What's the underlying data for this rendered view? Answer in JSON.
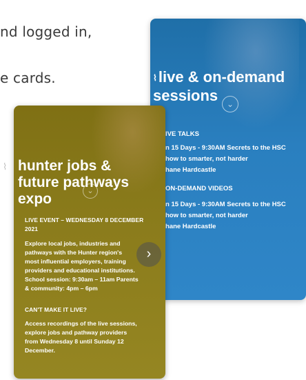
{
  "background_text": {
    "line1": "nd logged in,",
    "line2": "e cards."
  },
  "blue_card": {
    "title_line1": "live & on-demand",
    "title_line2": "sessions",
    "section1_heading": "IVE TALKS",
    "section1_lines": [
      "n 15 Days - 9:30AM Secrets to the HSC",
      "how to smarter, not harder",
      "hane Hardcastle"
    ],
    "section2_heading": "ON-DEMAND VIDEOS",
    "section2_lines": [
      "n 15 Days - 9:30AM Secrets to the HSC",
      "how to smarter, not harder",
      "hane Hardcastle"
    ],
    "accent": "#2a7fbf"
  },
  "olive_card": {
    "title_line1": "hunter jobs &",
    "title_line2": "future pathways",
    "title_line3": "expo",
    "event_label_line1": "LIVE EVENT – WEDNESDAY 8 DECEMBER",
    "event_label_line2": "2021",
    "description": [
      "Explore local jobs, industries and",
      "pathways with the Hunter region's",
      "most influential employers, training",
      "providers and educational institutions.",
      "School session: 9:30am – 11am Parents",
      "& community: 4pm – 6pm"
    ],
    "cant_make_label": "CAN'T MAKE IT LIVE?",
    "recordings": [
      "Access recordings of the live sessions,",
      "explore jobs and pathway providers",
      "from Wednesday 8 until Sunday 12",
      "December."
    ],
    "next_glyph": "›",
    "accent": "#8a7b1b"
  }
}
